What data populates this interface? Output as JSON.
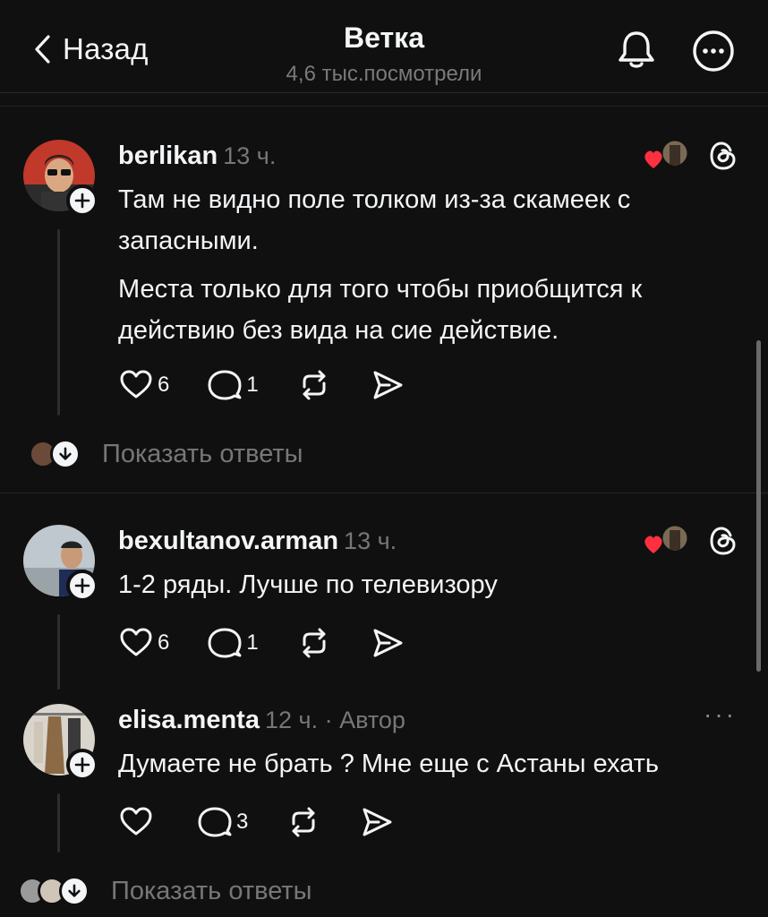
{
  "header": {
    "back_label": "Назад",
    "title": "Ветка",
    "views": "4,6 тыс.посмотрели"
  },
  "posts": [
    {
      "username": "berlikan",
      "time": "13 ч.",
      "lines": [
        "Там не видно поле толком из-за скамеек с",
        "запасными.",
        "Места только для того чтобы приобщится к",
        "действию без вида на сие действие."
      ],
      "likes": "6",
      "replies": "1"
    },
    {
      "username": "bexultanov.arman",
      "time": "13 ч.",
      "lines": [
        "1-2 ряды. Лучше по телевизору"
      ],
      "likes": "6",
      "replies": "1"
    },
    {
      "username": "elisa.menta",
      "time": "12 ч. · Автор",
      "lines": [
        "Думаете не брать ? Мне еще с Астаны ехать"
      ],
      "likes": "",
      "replies": "3"
    }
  ],
  "show_replies_label": "Показать ответы",
  "icons": {
    "back": "chevron-left-icon",
    "bell": "bell-icon",
    "more": "more-circle-icon",
    "like": "heart-icon",
    "reply": "comment-icon",
    "repost": "repost-icon",
    "share": "send-icon",
    "threads": "threads-icon"
  },
  "colors": {
    "background": "#101010",
    "text": "#f3f5f7",
    "muted": "#777777",
    "heart": "#ff3040"
  }
}
